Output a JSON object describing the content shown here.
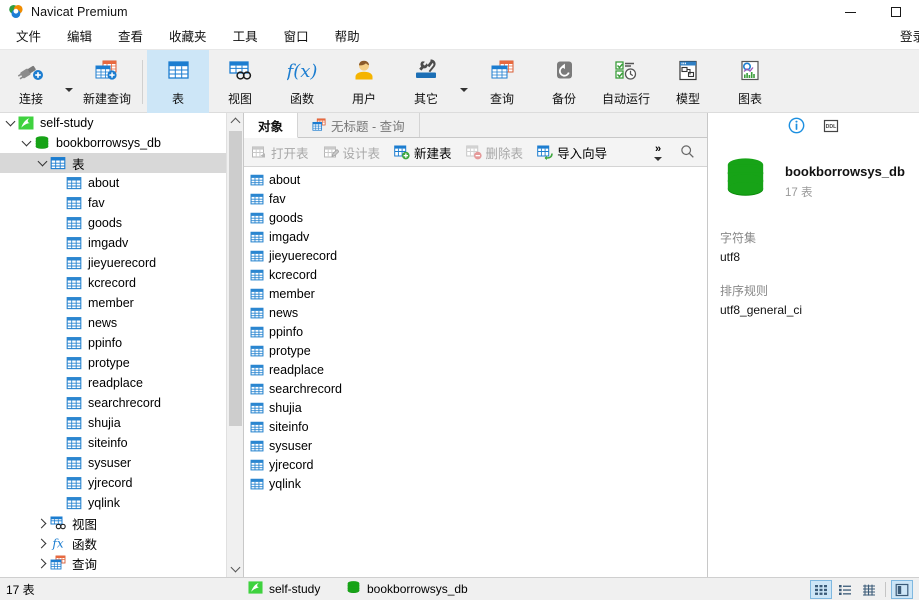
{
  "window": {
    "title": "Navicat Premium",
    "app_icon": "navicat-logo-icon",
    "minimize": "minimize-icon",
    "maximize": "maximize-icon"
  },
  "menubar": {
    "items": [
      {
        "label": "文件",
        "name": "menu-file"
      },
      {
        "label": "编辑",
        "name": "menu-edit"
      },
      {
        "label": "查看",
        "name": "menu-view"
      },
      {
        "label": "收藏夹",
        "name": "menu-favorites"
      },
      {
        "label": "工具",
        "name": "menu-tools"
      },
      {
        "label": "窗口",
        "name": "menu-window"
      },
      {
        "label": "帮助",
        "name": "menu-help"
      }
    ],
    "login_label": "登录"
  },
  "ribbon": {
    "buttons": [
      {
        "label": "连接",
        "icon": "connection-icon",
        "selected": false,
        "dropdown": true
      },
      {
        "label": "新建查询",
        "icon": "new-query-icon",
        "selected": false,
        "dropdown": false
      },
      {
        "label": "表",
        "icon": "table-icon",
        "selected": true,
        "dropdown": false
      },
      {
        "label": "视图",
        "icon": "view-icon",
        "selected": false,
        "dropdown": false
      },
      {
        "label": "函数",
        "icon": "function-icon",
        "selected": false,
        "dropdown": false
      },
      {
        "label": "用户",
        "icon": "user-icon",
        "selected": false,
        "dropdown": false
      },
      {
        "label": "其它",
        "icon": "other-tools-icon",
        "selected": false,
        "dropdown": true
      },
      {
        "label": "查询",
        "icon": "query-icon",
        "selected": false,
        "dropdown": false
      },
      {
        "label": "备份",
        "icon": "backup-icon",
        "selected": false,
        "dropdown": false
      },
      {
        "label": "自动运行",
        "icon": "automation-icon",
        "selected": false,
        "dropdown": false
      },
      {
        "label": "模型",
        "icon": "model-icon",
        "selected": false,
        "dropdown": false
      },
      {
        "label": "图表",
        "icon": "chart-icon",
        "selected": false,
        "dropdown": false
      }
    ]
  },
  "tree": {
    "nodes": [
      {
        "label": "self-study",
        "indent": 0,
        "icon": "connection-node-icon",
        "expander": "down",
        "selected": false
      },
      {
        "label": "bookborrowsys_db",
        "indent": 1,
        "icon": "database-icon",
        "expander": "down",
        "selected": false
      },
      {
        "label": "表",
        "indent": 2,
        "icon": "table-folder-icon",
        "expander": "down",
        "selected": true
      },
      {
        "label": "about",
        "indent": 3,
        "icon": "table-icon",
        "expander": "none",
        "selected": false
      },
      {
        "label": "fav",
        "indent": 3,
        "icon": "table-icon",
        "expander": "none",
        "selected": false
      },
      {
        "label": "goods",
        "indent": 3,
        "icon": "table-icon",
        "expander": "none",
        "selected": false
      },
      {
        "label": "imgadv",
        "indent": 3,
        "icon": "table-icon",
        "expander": "none",
        "selected": false
      },
      {
        "label": "jieyuerecord",
        "indent": 3,
        "icon": "table-icon",
        "expander": "none",
        "selected": false
      },
      {
        "label": "kcrecord",
        "indent": 3,
        "icon": "table-icon",
        "expander": "none",
        "selected": false
      },
      {
        "label": "member",
        "indent": 3,
        "icon": "table-icon",
        "expander": "none",
        "selected": false
      },
      {
        "label": "news",
        "indent": 3,
        "icon": "table-icon",
        "expander": "none",
        "selected": false
      },
      {
        "label": "ppinfo",
        "indent": 3,
        "icon": "table-icon",
        "expander": "none",
        "selected": false
      },
      {
        "label": "protype",
        "indent": 3,
        "icon": "table-icon",
        "expander": "none",
        "selected": false
      },
      {
        "label": "readplace",
        "indent": 3,
        "icon": "table-icon",
        "expander": "none",
        "selected": false
      },
      {
        "label": "searchrecord",
        "indent": 3,
        "icon": "table-icon",
        "expander": "none",
        "selected": false
      },
      {
        "label": "shujia",
        "indent": 3,
        "icon": "table-icon",
        "expander": "none",
        "selected": false
      },
      {
        "label": "siteinfo",
        "indent": 3,
        "icon": "table-icon",
        "expander": "none",
        "selected": false
      },
      {
        "label": "sysuser",
        "indent": 3,
        "icon": "table-icon",
        "expander": "none",
        "selected": false
      },
      {
        "label": "yjrecord",
        "indent": 3,
        "icon": "table-icon",
        "expander": "none",
        "selected": false
      },
      {
        "label": "yqlink",
        "indent": 3,
        "icon": "table-icon",
        "expander": "none",
        "selected": false
      },
      {
        "label": "视图",
        "indent": 2,
        "icon": "view-icon",
        "expander": "right",
        "selected": false
      },
      {
        "label": "函数",
        "indent": 2,
        "icon": "function-icon",
        "expander": "right",
        "selected": false
      },
      {
        "label": "查询",
        "indent": 2,
        "icon": "query-icon",
        "expander": "right",
        "selected": false
      }
    ]
  },
  "tabs": [
    {
      "label": "对象",
      "icon": "",
      "active": true
    },
    {
      "label": "无标题 - 查询",
      "icon": "query-icon",
      "active": false
    }
  ],
  "objbar": {
    "buttons": [
      {
        "label": "打开表",
        "icon": "open-table-icon",
        "enabled": false
      },
      {
        "label": "设计表",
        "icon": "design-table-icon",
        "enabled": false
      },
      {
        "label": "新建表",
        "icon": "new-table-icon",
        "enabled": true
      },
      {
        "label": "删除表",
        "icon": "delete-table-icon",
        "enabled": false
      },
      {
        "label": "导入向导",
        "icon": "import-wizard-icon",
        "enabled": true
      }
    ],
    "overflow": "»",
    "search_icon": "search-icon"
  },
  "objlist": {
    "items": [
      "about",
      "fav",
      "goods",
      "imgadv",
      "jieyuerecord",
      "kcrecord",
      "member",
      "news",
      "ppinfo",
      "protype",
      "readplace",
      "searchrecord",
      "shujia",
      "siteinfo",
      "sysuser",
      "yjrecord",
      "yqlink"
    ]
  },
  "info": {
    "info_button": "info-icon",
    "ddl_button": "ddl-icon",
    "db_icon": "database-icon",
    "db_name": "bookborrowsys_db",
    "db_count": "17 表",
    "charset_label": "字符集",
    "charset_value": "utf8",
    "collation_label": "排序规则",
    "collation_value": "utf8_general_ci"
  },
  "status": {
    "count": "17 表",
    "connection": "self-study",
    "database": "bookborrowsys_db",
    "views": [
      {
        "name": "grid-view-button",
        "icon": "grid-icon",
        "active": true
      },
      {
        "name": "list-view-button",
        "icon": "list-icon",
        "active": false
      },
      {
        "name": "detail-view-button",
        "icon": "detail-icon",
        "active": false
      },
      {
        "name": "preview-pane-button",
        "icon": "preview-icon",
        "active": true
      }
    ]
  },
  "colors": {
    "accent": "#1c7dd0",
    "selection": "#cde6f7",
    "green": "#1a9a1a",
    "orange": "#e8693f",
    "toolbar_bg": "#f0f0f0"
  }
}
